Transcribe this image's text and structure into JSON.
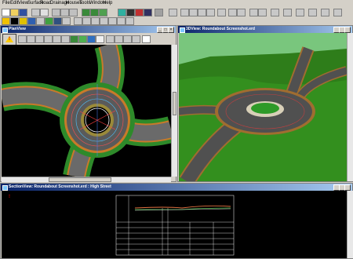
{
  "menu": [
    "File",
    "Edit",
    "View",
    "Surface",
    "Road",
    "Drainage",
    "Houses",
    "Tools",
    "Window",
    "Help"
  ],
  "plan_window": {
    "title": "PlanView",
    "min": "_",
    "max": "□",
    "close": "×"
  },
  "view3d_window": {
    "title": "3DView: Roundabout Screenshot.erd"
  },
  "section_window": {
    "title": "SectionView: Roundabout Screenshot.erd : High Street"
  },
  "warning_glyph": "!",
  "colors": {
    "title_start": "#0a246a",
    "title_end": "#a6caf0",
    "canvas": "#000000",
    "sky": "#79c67d",
    "grass": "#2e7d1a"
  }
}
